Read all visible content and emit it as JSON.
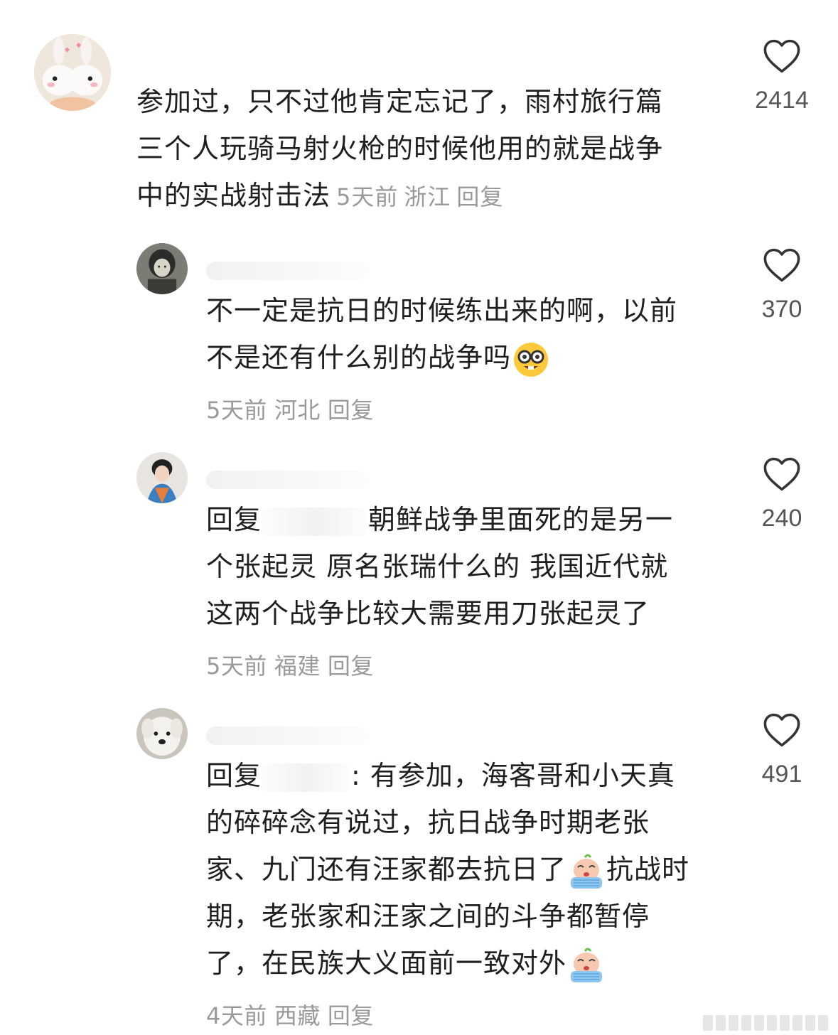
{
  "comments": [
    {
      "lines": [
        "参加过，只不过他肯定忘记了，雨村旅行篇",
        "三个人玩骑马射火枪的时候他用的就是战争",
        "中的实战射击法"
      ],
      "time": "5天前",
      "location": "浙江",
      "reply": "回复",
      "likes": "2414"
    },
    {
      "lines": [
        "不一定是抗日的时候练出来的啊，以前",
        "不是还有什么别的战争吗"
      ],
      "time": "5天前",
      "location": "河北",
      "reply": "回复",
      "likes": "370"
    },
    {
      "reply_prefix": "回复",
      "line1_rest": "朝鲜战争里面死的是另一",
      "lines": [
        "个张起灵 原名张瑞什么的 我国近代就",
        "这两个战争比较大需要用刀张起灵了"
      ],
      "time": "5天前",
      "location": "福建",
      "reply": "回复",
      "likes": "240"
    },
    {
      "reply_prefix": "回复",
      "line1_rest": ": 有参加，海客哥和小天真",
      "line2": "的碎碎念有说过，抗日战争时期老张",
      "line3a": "家、九门还有汪家都去抗日了",
      "line3b": "抗战时",
      "line4": "期，老张家和汪家之间的斗争都暂停",
      "line5": "了，在民族大义面前一致对外",
      "time": "4天前",
      "location": "西藏",
      "reply": "回复",
      "likes": "491"
    }
  ],
  "icons": {
    "like": "heart-outline-icon",
    "emoji_nerd": "nerd-face-emoji",
    "emoji_crying": "crying-face-emoji"
  },
  "colors": {
    "text": "#1f1f1f",
    "meta": "#9a9a9a",
    "like_count": "#555555"
  }
}
